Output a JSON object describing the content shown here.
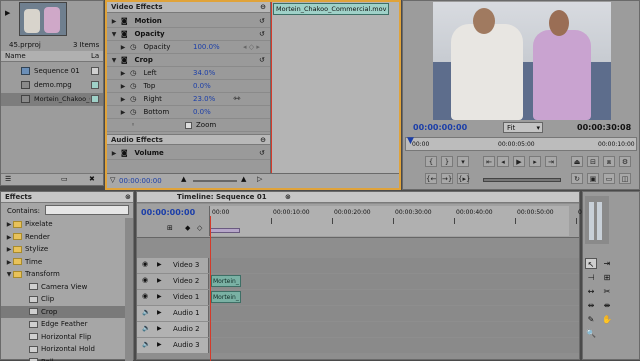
{
  "project": {
    "file": "45.prproj",
    "item_count": "3 Items",
    "col_name": "Name",
    "col_label": "La",
    "items": [
      {
        "name": "Sequence 01"
      },
      {
        "name": "demo.mpg"
      },
      {
        "name": "Mortein_Chakoo_Commercial"
      }
    ]
  },
  "effect_controls": {
    "header": "Video Effects",
    "clip_tab": "Mortein_Chakoo_Commercial.mov",
    "motion": "Motion",
    "opacity": "Opacity",
    "opacity_prop": "Opacity",
    "opacity_val": "100.0%",
    "crop": "Crop",
    "left": "Left",
    "left_val": "34.0%",
    "top": "Top",
    "top_val": "0.0%",
    "right": "Right",
    "right_val": "23.0%",
    "bottom": "Bottom",
    "bottom_val": "0.0%",
    "zoom": "Zoom",
    "audio_header": "Audio Effects",
    "volume": "Volume",
    "timecode": "00:00:00:00"
  },
  "program": {
    "timecode": "00:00:00:00",
    "fit": "Fit",
    "duration": "00:00:30:08",
    "ruler_start": "00:00",
    "ruler_end": "00:00:10:00",
    "ruler_mid": "00:00:05:00"
  },
  "effects": {
    "tab": "Effects",
    "contains": "Contains:",
    "tree": [
      {
        "label": "Pixelate",
        "type": "folder"
      },
      {
        "label": "Render",
        "type": "folder"
      },
      {
        "label": "Stylize",
        "type": "folder"
      },
      {
        "label": "Time",
        "type": "folder"
      },
      {
        "label": "Transform",
        "type": "folder-open"
      },
      {
        "label": "Camera View",
        "type": "effect"
      },
      {
        "label": "Clip",
        "type": "effect"
      },
      {
        "label": "Crop",
        "type": "effect-selected"
      },
      {
        "label": "Edge Feather",
        "type": "effect"
      },
      {
        "label": "Horizontal Flip",
        "type": "effect"
      },
      {
        "label": "Horizontal Hold",
        "type": "effect"
      },
      {
        "label": "Roll",
        "type": "effect"
      }
    ]
  },
  "timeline": {
    "tab": "Timeline: Sequence 01",
    "timecode": "00:00:00:00",
    "ruler": [
      "00:00",
      "00:00:10:00",
      "00:00:20:00",
      "00:00:30:00",
      "00:00:40:00",
      "00:00:50:00",
      "00:01:00:00"
    ],
    "tracks": [
      {
        "name": "Video 3",
        "kind": "video",
        "clip": ""
      },
      {
        "name": "Video 2",
        "kind": "video",
        "clip": "Mortein_"
      },
      {
        "name": "Video 1",
        "kind": "video",
        "clip": "Mortein_"
      },
      {
        "name": "Audio 1",
        "kind": "audio",
        "clip": ""
      },
      {
        "name": "Audio 2",
        "kind": "audio",
        "clip": ""
      },
      {
        "name": "Audio 3",
        "kind": "audio",
        "clip": ""
      }
    ]
  },
  "colors": {
    "accent": "#1b3ea8",
    "clip": "#7ab1a4",
    "playhead": "#d43a2a",
    "selection": "#e0a33a"
  }
}
